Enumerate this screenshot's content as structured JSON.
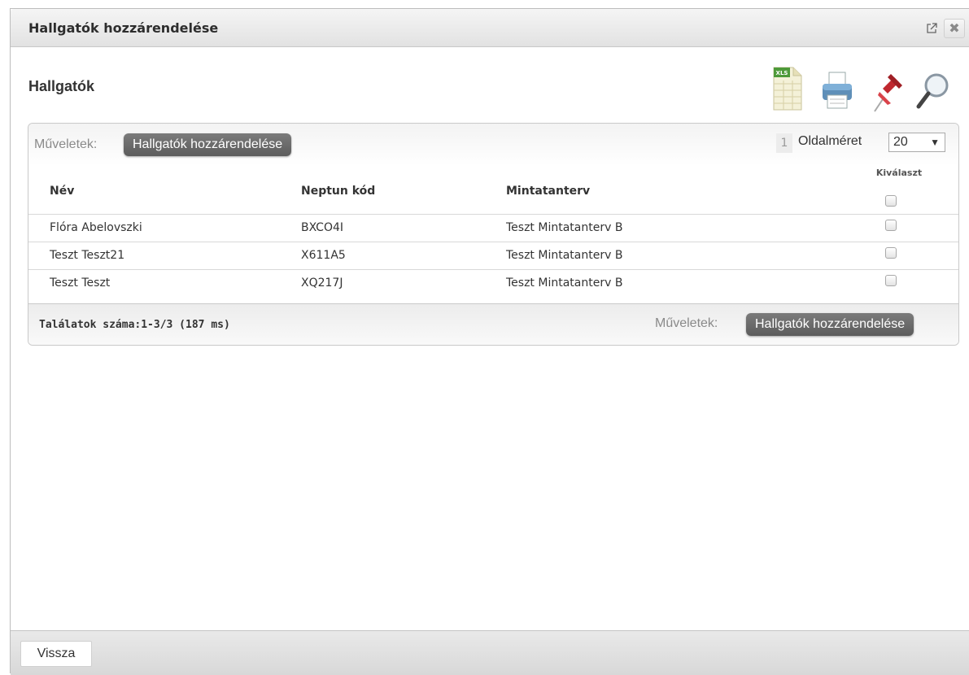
{
  "window": {
    "title": "Hallgatók hozzárendelése"
  },
  "section": {
    "title": "Hallgatók"
  },
  "toolbar": {
    "icons": [
      "xls-export-icon",
      "print-icon",
      "pin-icon",
      "search-icon"
    ],
    "xls_badge": "XLS"
  },
  "actions": {
    "label": "Műveletek:",
    "button_label": "Hallgatók hozzárendelése"
  },
  "pagination": {
    "current_page": "1",
    "page_size_label": "Oldalméret",
    "page_size_value": "20",
    "page_size_arrow": "▼"
  },
  "table": {
    "columns": {
      "name": "Név",
      "neptun": "Neptun kód",
      "curriculum": "Mintatanterv",
      "select": "Kiválaszt"
    },
    "rows": [
      {
        "name": "Flóra Abelovszki",
        "neptun": "BXCO4I",
        "curriculum": "Teszt Mintatanterv B",
        "selected": false
      },
      {
        "name": "Teszt Teszt21",
        "neptun": "X611A5",
        "curriculum": "Teszt Mintatanterv B",
        "selected": false
      },
      {
        "name": "Teszt Teszt",
        "neptun": "XQ217J",
        "curriculum": "Teszt Mintatanterv B",
        "selected": false
      }
    ]
  },
  "footer": {
    "results_text": "Találatok száma:1-3/3 (187 ms)"
  },
  "bottom": {
    "back_label": "Vissza"
  },
  "colors": {
    "action_button": "#6b6b6b",
    "pin": "#c0282f",
    "xls": "#4e9a3a"
  }
}
